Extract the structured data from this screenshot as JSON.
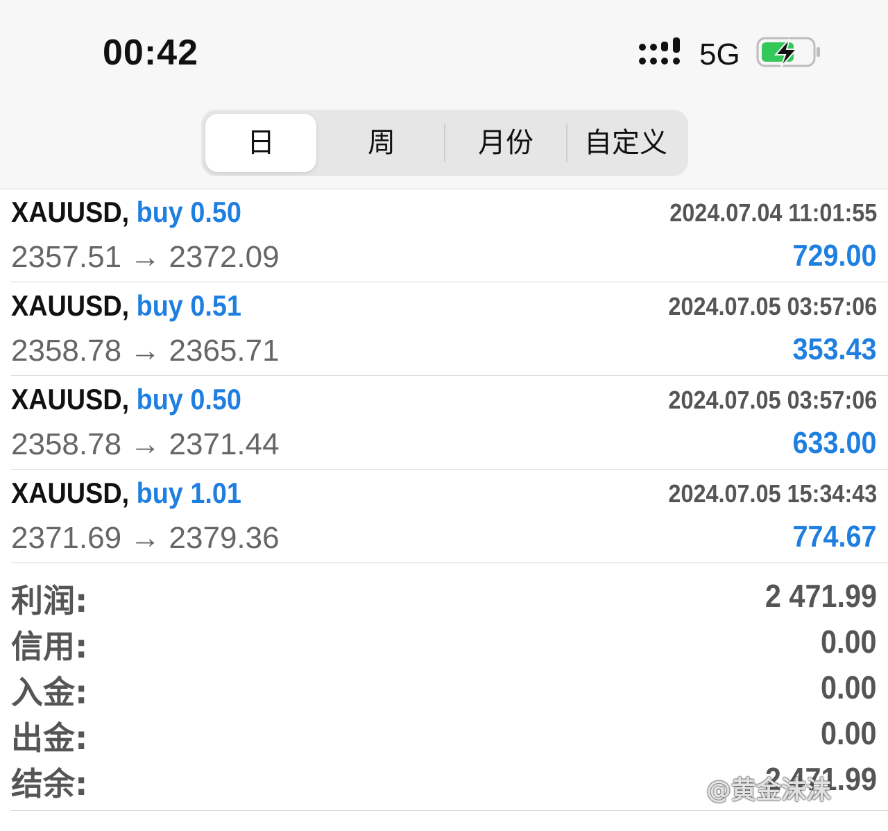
{
  "status_bar": {
    "time": "00:42",
    "network": "5G",
    "icons": {
      "signal": "signal-bars-icon",
      "battery": "battery-charging-icon"
    },
    "battery_color": "#34c759"
  },
  "period_tabs": {
    "items": [
      {
        "label": "日",
        "active": true
      },
      {
        "label": "周",
        "active": false
      },
      {
        "label": "月份",
        "active": false
      },
      {
        "label": "自定义",
        "active": false
      }
    ]
  },
  "trades": [
    {
      "symbol": "XAUUSD,",
      "side": "buy 0.50",
      "time": "2024.07.04 11:01:55",
      "open_price": "2357.51",
      "arrow": "→",
      "close_price": "2372.09",
      "profit": "729.00"
    },
    {
      "symbol": "XAUUSD,",
      "side": "buy 0.51",
      "time": "2024.07.05 03:57:06",
      "open_price": "2358.78",
      "arrow": "→",
      "close_price": "2365.71",
      "profit": "353.43"
    },
    {
      "symbol": "XAUUSD,",
      "side": "buy 0.50",
      "time": "2024.07.05 03:57:06",
      "open_price": "2358.78",
      "arrow": "→",
      "close_price": "2371.44",
      "profit": "633.00"
    },
    {
      "symbol": "XAUUSD,",
      "side": "buy 1.01",
      "time": "2024.07.05 15:34:43",
      "open_price": "2371.69",
      "arrow": "→",
      "close_price": "2379.36",
      "profit": "774.67"
    }
  ],
  "summary": [
    {
      "label": "利润:",
      "value": "2 471.99"
    },
    {
      "label": "信用:",
      "value": "0.00"
    },
    {
      "label": "入金:",
      "value": "0.00"
    },
    {
      "label": "出金:",
      "value": "0.00"
    },
    {
      "label": "结余:",
      "value": "2 471.99"
    }
  ],
  "watermark": "@黄金沫沫",
  "colors": {
    "accent_blue": "#1f7fe0",
    "text_dark": "#111111",
    "text_gray": "#555555"
  }
}
